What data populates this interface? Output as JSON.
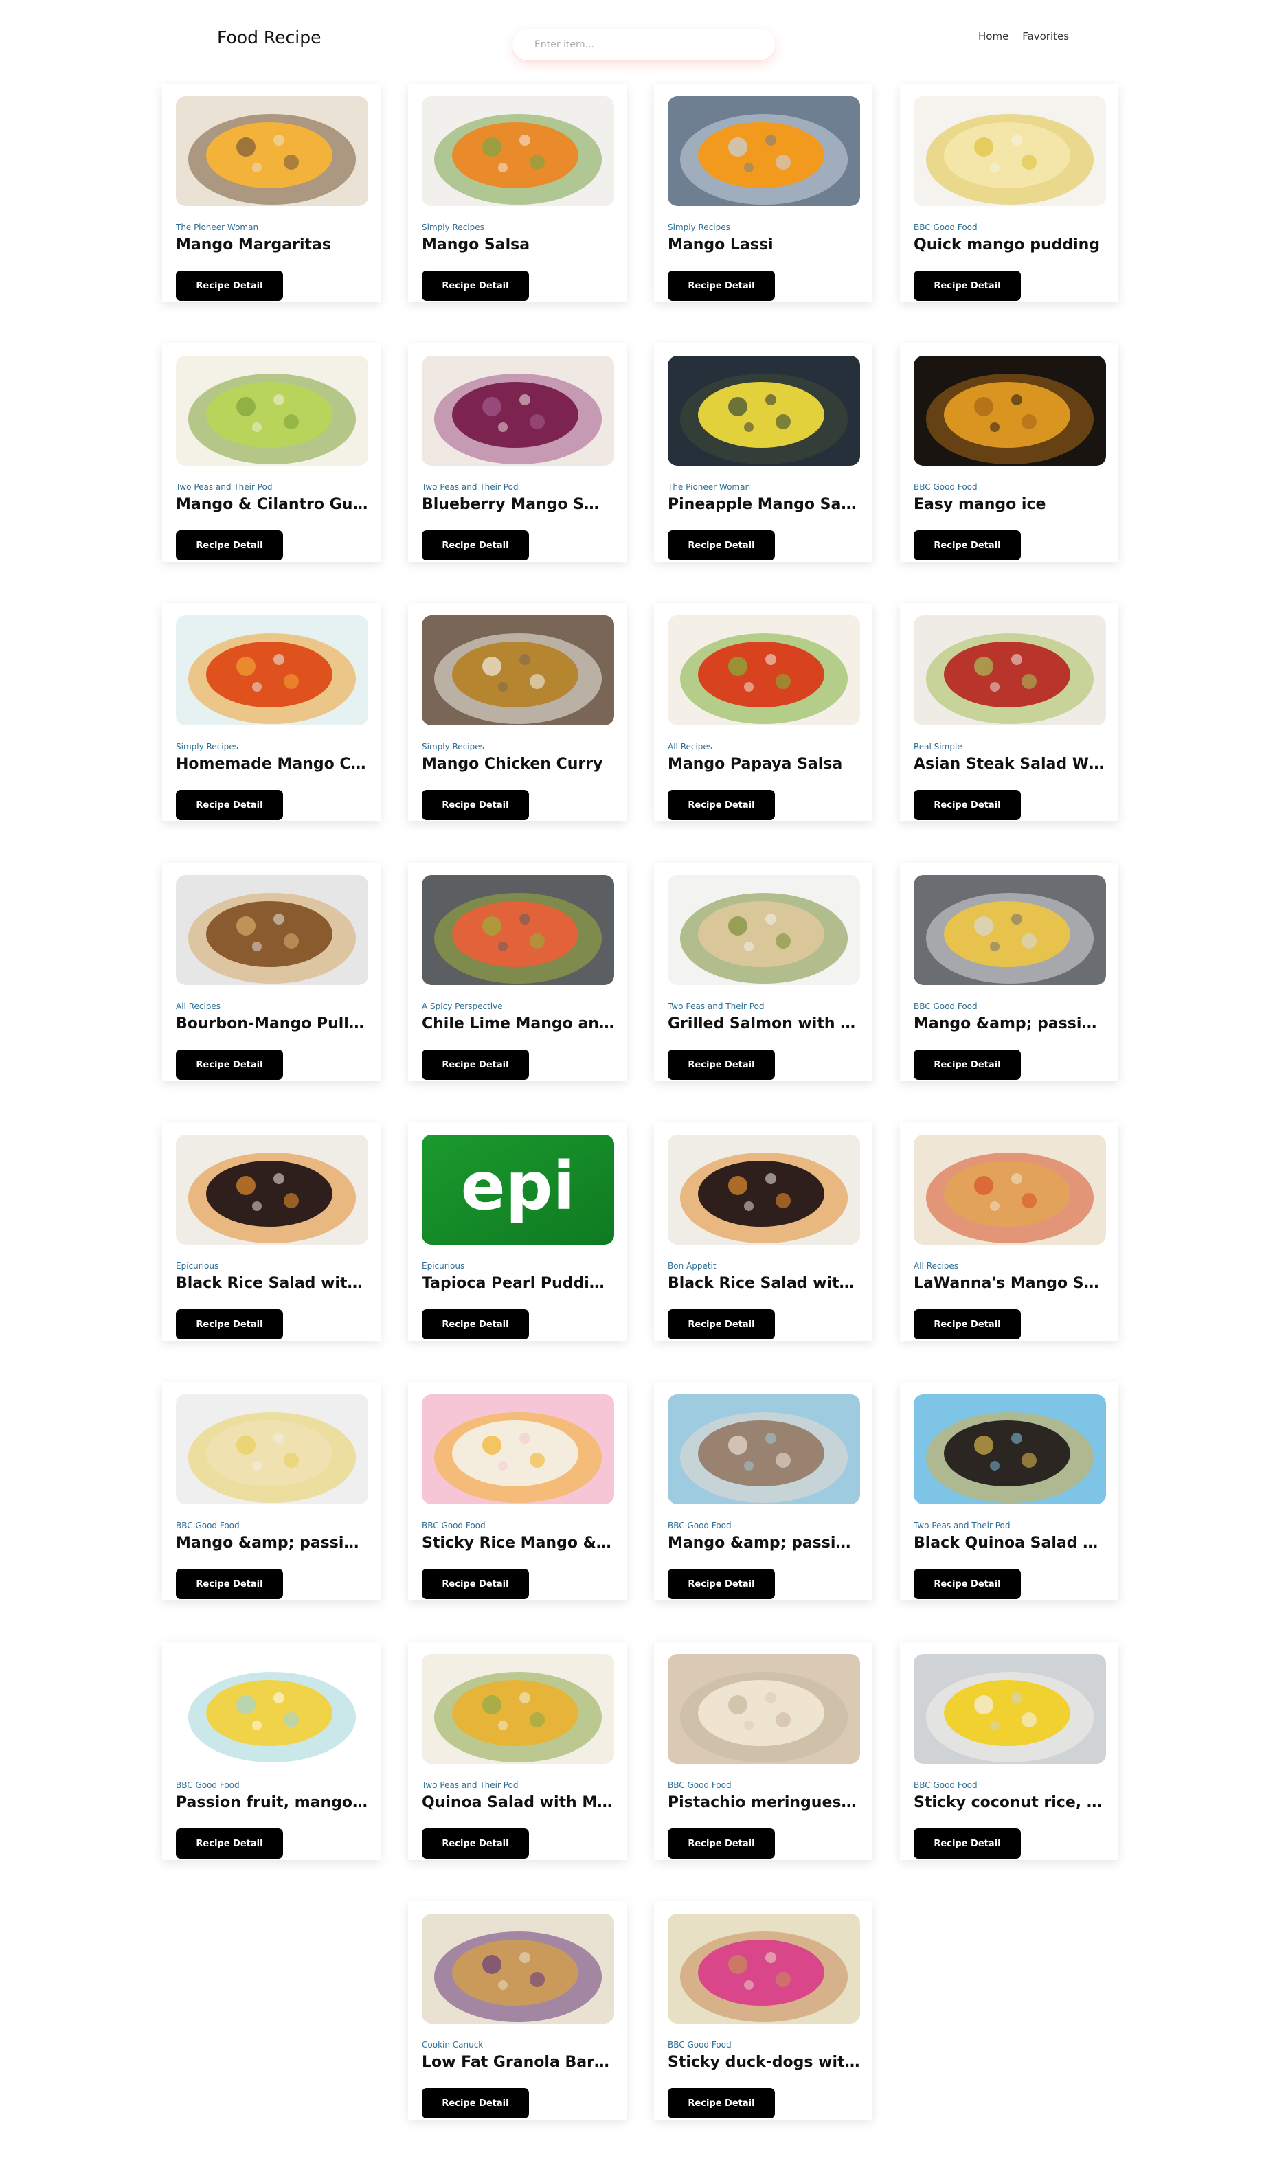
{
  "header": {
    "brand": "Food Recipe",
    "search_placeholder": "Enter item...",
    "nav": [
      "Home",
      "Favorites"
    ]
  },
  "button_label": "Recipe Detail",
  "recipes": [
    {
      "publisher": "The Pioneer Woman",
      "title": "Mango Margaritas",
      "img": [
        "#f3b33a",
        "#7a5a3c",
        "#e9e2d5"
      ]
    },
    {
      "publisher": "Simply Recipes",
      "title": "Mango Salsa",
      "img": [
        "#e98b2a",
        "#7aa64a",
        "#f2f0ec"
      ]
    },
    {
      "publisher": "Simply Recipes",
      "title": "Mango Lassi",
      "img": [
        "#f29a1e",
        "#c8d3e0",
        "#6f7f92"
      ]
    },
    {
      "publisher": "BBC Good Food",
      "title": "Quick mango pudding",
      "img": [
        "#f3e6a8",
        "#e0c13d",
        "#f5f3ee"
      ]
    },
    {
      "publisher": "Two Peas and Their Pod",
      "title": "Mango & Cilantro Gua...",
      "img": [
        "#b9d45a",
        "#7fa33a",
        "#f4f1e6"
      ]
    },
    {
      "publisher": "Two Peas and Their Pod",
      "title": "Blueberry Mango Smo...",
      "img": [
        "#7d2350",
        "#a25a8a",
        "#efe8e3"
      ]
    },
    {
      "publisher": "The Pioneer Woman",
      "title": "Pineapple Mango Salsa",
      "img": [
        "#e2d13b",
        "#3c4a35",
        "#26303b"
      ]
    },
    {
      "publisher": "BBC Good Food",
      "title": "Easy mango ice",
      "img": [
        "#d9951f",
        "#a56617",
        "#1a1410"
      ]
    },
    {
      "publisher": "Simply Recipes",
      "title": "Homemade Mango Ch...",
      "img": [
        "#e0521d",
        "#f0a233",
        "#e6f1f1"
      ]
    },
    {
      "publisher": "Simply Recipes",
      "title": "Mango Chicken Curry",
      "img": [
        "#b5852f",
        "#f1ece3",
        "#7a6657"
      ]
    },
    {
      "publisher": "All Recipes",
      "title": "Mango Papaya Salsa",
      "img": [
        "#d9421f",
        "#7fb33a",
        "#f4f0e8"
      ]
    },
    {
      "publisher": "Real Simple",
      "title": "Asian Steak Salad Wit...",
      "img": [
        "#b9342a",
        "#a7c05a",
        "#efece6"
      ]
    },
    {
      "publisher": "All Recipes",
      "title": "Bourbon-Mango Pulle...",
      "img": [
        "#8a5b2e",
        "#d7a96a",
        "#e6e6e6"
      ]
    },
    {
      "publisher": "A Spicy Perspective",
      "title": "Chile Lime Mango and...",
      "img": [
        "#e2623a",
        "#9aae3a",
        "#5c5f62"
      ]
    },
    {
      "publisher": "Two Peas and Their Pod",
      "title": "Grilled Salmon with M...",
      "img": [
        "#d9c79a",
        "#7a8f3a",
        "#f3f3f1"
      ]
    },
    {
      "publisher": "BBC Good Food",
      "title": "Mango &amp; passion...",
      "img": [
        "#e7c24c",
        "#d7d9dc",
        "#6a6d72"
      ]
    },
    {
      "publisher": "Epicurious",
      "title": "Black Rice Salad with ...",
      "img": [
        "#2e1e1c",
        "#e38b2c",
        "#f0ede6"
      ]
    },
    {
      "publisher": "Epicurious",
      "title": "Tapioca Pearl Pudding ...",
      "img": [
        "#1b9a2d",
        "#0f7a22",
        "#ffffff"
      ],
      "logo": "epi"
    },
    {
      "publisher": "Bon Appetit",
      "title": "Black Rice Salad with ...",
      "img": [
        "#2e1e1c",
        "#e38b2c",
        "#f0ede6"
      ]
    },
    {
      "publisher": "All Recipes",
      "title": "LaWanna's Mango Sals...",
      "img": [
        "#e2a25a",
        "#d9532a",
        "#f0e6d6"
      ]
    },
    {
      "publisher": "BBC Good Food",
      "title": "Mango &amp; passion...",
      "img": [
        "#f0e2b0",
        "#e7cf5c",
        "#efefef"
      ]
    },
    {
      "publisher": "BBC Good Food",
      "title": "Sticky Rice Mango &a...",
      "img": [
        "#f4ecdc",
        "#f2b52b",
        "#f7c6d6"
      ]
    },
    {
      "publisher": "BBC Good Food",
      "title": "Mango &amp; passion...",
      "img": [
        "#9a8270",
        "#e8ddd2",
        "#9ecbe0"
      ]
    },
    {
      "publisher": "Two Peas and Their Pod",
      "title": "Black Quinoa Salad wit...",
      "img": [
        "#2b2622",
        "#d6b04a",
        "#7ec4e6"
      ]
    },
    {
      "publisher": "BBC Good Food",
      "title": "Passion fruit, mango ...",
      "img": [
        "#f1d34a",
        "#9fd6d8",
        "#ffffff"
      ]
    },
    {
      "publisher": "Two Peas and Their Pod",
      "title": "Quinoa Salad with Ma...",
      "img": [
        "#e7b43a",
        "#8da94a",
        "#f3efe4"
      ]
    },
    {
      "publisher": "BBC Good Food",
      "title": "Pistachio meringues w...",
      "img": [
        "#efe4d0",
        "#c6b8a0",
        "#d9c9b5"
      ]
    },
    {
      "publisher": "BBC Good Food",
      "title": "Sticky coconut rice, m...",
      "img": [
        "#f1d12f",
        "#f4f2ec",
        "#cfd3d6"
      ]
    },
    {
      "publisher": "Cookin Canuck",
      "title": "Low Fat Granola Bars ...",
      "img": [
        "#c99a5a",
        "#6a3d7a",
        "#e9e2d3"
      ]
    },
    {
      "publisher": "BBC Good Food",
      "title": "Sticky duck-dogs with ...",
      "img": [
        "#d9468a",
        "#c98b5a",
        "#e8e0c4"
      ]
    }
  ]
}
